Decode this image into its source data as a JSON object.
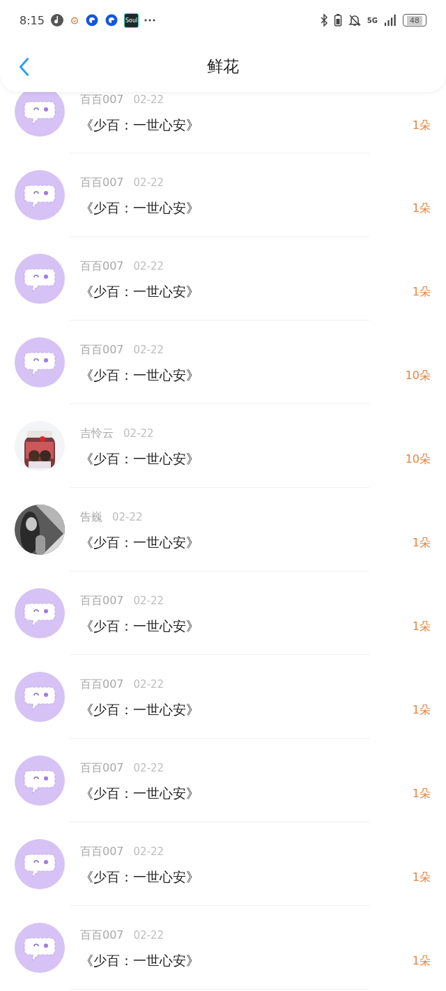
{
  "status_bar": {
    "time": "8:15",
    "app_label": "Soul",
    "network": "5G",
    "battery": "48"
  },
  "header": {
    "title": "鲜花"
  },
  "rows": [
    {
      "kind": "default",
      "name": "百百007",
      "date": "02-22",
      "title": "《少百：一世心安》",
      "count": "1朵"
    },
    {
      "kind": "default",
      "name": "百百007",
      "date": "02-22",
      "title": "《少百：一世心安》",
      "count": "1朵"
    },
    {
      "kind": "default",
      "name": "百百007",
      "date": "02-22",
      "title": "《少百：一世心安》",
      "count": "1朵"
    },
    {
      "kind": "default",
      "name": "百百007",
      "date": "02-22",
      "title": "《少百：一世心安》",
      "count": "10朵"
    },
    {
      "kind": "picture",
      "name": "吉怜云",
      "date": "02-22",
      "title": "《少百：一世心安》",
      "count": "10朵"
    },
    {
      "kind": "picture",
      "name": "告巍",
      "date": "02-22",
      "title": "《少百：一世心安》",
      "count": "1朵"
    },
    {
      "kind": "default",
      "name": "百百007",
      "date": "02-22",
      "title": "《少百：一世心安》",
      "count": "1朵"
    },
    {
      "kind": "default",
      "name": "百百007",
      "date": "02-22",
      "title": "《少百：一世心安》",
      "count": "1朵"
    },
    {
      "kind": "default",
      "name": "百百007",
      "date": "02-22",
      "title": "《少百：一世心安》",
      "count": "1朵"
    },
    {
      "kind": "default",
      "name": "百百007",
      "date": "02-22",
      "title": "《少百：一世心安》",
      "count": "1朵"
    },
    {
      "kind": "default",
      "name": "百百007",
      "date": "02-22",
      "title": "《少百：一世心安》",
      "count": "1朵"
    }
  ]
}
